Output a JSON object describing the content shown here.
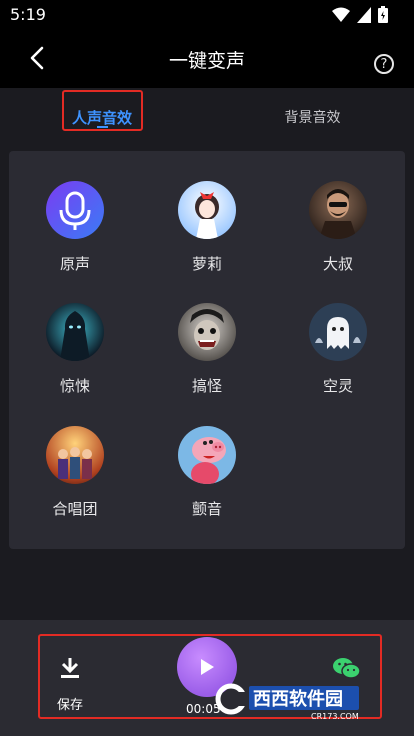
{
  "status_bar": {
    "time": "5:19"
  },
  "header": {
    "title": "一键变声",
    "help_label": "?"
  },
  "tabs": [
    {
      "label": "人声音效",
      "active": true
    },
    {
      "label": "背景音效",
      "active": false
    }
  ],
  "effects": [
    {
      "label": "原声",
      "icon": "microphone-icon"
    },
    {
      "label": "萝莉",
      "icon": "loli-avatar"
    },
    {
      "label": "大叔",
      "icon": "uncle-avatar"
    },
    {
      "label": "惊悚",
      "icon": "horror-avatar"
    },
    {
      "label": "搞怪",
      "icon": "funny-avatar"
    },
    {
      "label": "空灵",
      "icon": "ghost-avatar"
    },
    {
      "label": "合唱团",
      "icon": "choir-avatar"
    },
    {
      "label": "颤音",
      "icon": "pig-avatar"
    }
  ],
  "bottom_bar": {
    "save_label": "保存",
    "play_time": "00:05",
    "share_icon": "wechat-icon"
  },
  "watermark": {
    "text": "西西软件园",
    "subtext": "CR173.COM"
  },
  "colors": {
    "accent": "#3e93ff",
    "highlight": "#e32b24",
    "panel": "#2b2b33",
    "play": "#a86bf0",
    "wechat": "#3bd16f"
  }
}
